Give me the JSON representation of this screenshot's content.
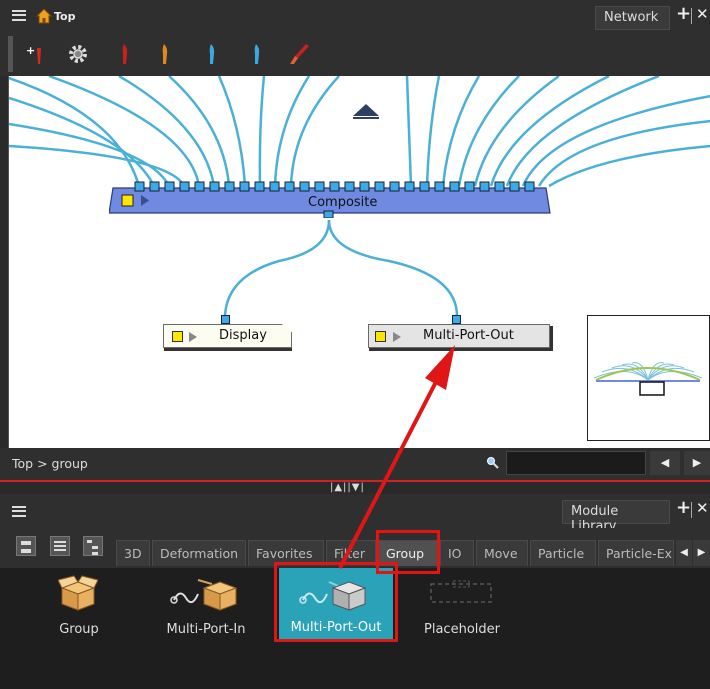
{
  "network": {
    "breadcrumb_title": "Top",
    "panel_tab": "Network",
    "toolbar_icons": [
      "add-peg-icon",
      "gear-icon",
      "red-brush-icon",
      "orange-brush-icon",
      "blue-brush-icon",
      "blue-brush-2-icon",
      "red-paint-icon"
    ],
    "nodes": {
      "composite": "Composite",
      "display": "Display",
      "multi_port_out": "Multi-Port-Out"
    },
    "path": "Top > group"
  },
  "library": {
    "panel_tab": "Module Library",
    "tabs": [
      "3D",
      "Deformation",
      "Favorites",
      "Filter",
      "Group",
      "IO",
      "Move",
      "Particle",
      "Particle-Ex"
    ],
    "active_tab": "Group",
    "modules": [
      "Group",
      "Multi-Port-In",
      "Multi-Port-Out",
      "Placeholder"
    ],
    "selected_module": "Multi-Port-Out"
  },
  "colors": {
    "accent": "#3fa9e6",
    "annotation": "#e01616",
    "composite_node": "#6f8ae0",
    "selected_tile": "#2aa3b9"
  }
}
